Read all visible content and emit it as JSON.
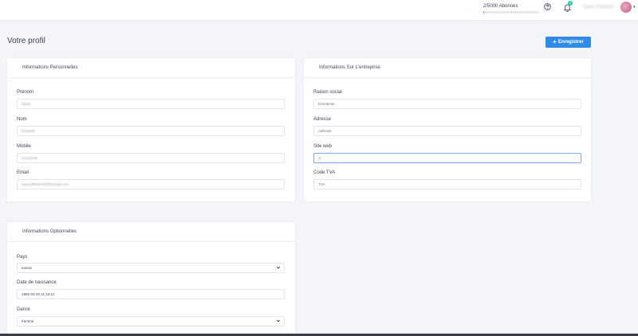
{
  "header": {
    "subscribers_text": "2/5000  Abonnés",
    "subscribers_progress": 0.0004,
    "notification_count": "0",
    "username": "Nadia Khamidi",
    "icons": {
      "help": "help-circle-icon",
      "bell": "bell-icon",
      "caret": "caret-down-icon"
    }
  },
  "page": {
    "title": "Votre profil",
    "save_label": "Enregistrer",
    "accent_color": "#2f8be6"
  },
  "personal": {
    "title": "Informations Personnelles",
    "fields": [
      {
        "label": "Prénom",
        "value": "Nadia"
      },
      {
        "label": "Nom",
        "value": "Khamidi"
      },
      {
        "label": "Mobile",
        "value": "22115039"
      },
      {
        "label": "Email",
        "value": "bayoudkhamidi@hotmail.com"
      }
    ]
  },
  "company": {
    "title": "Informations Sur L'entreprise",
    "fields": [
      {
        "label": "Raison social",
        "placeholder": "Entreprise"
      },
      {
        "label": "Adresse",
        "placeholder": "Adresse"
      },
      {
        "label": "Site web",
        "value": "-|"
      },
      {
        "label": "Code TVA",
        "placeholder": "TVA"
      }
    ]
  },
  "optional": {
    "title": "Informations Optionnelles",
    "fields": [
      {
        "label": "Pays",
        "value": "tunisie"
      },
      {
        "label": "Date de naissance",
        "value": "1992-03-20 11:12:12"
      },
      {
        "label": "Genre",
        "value": "Femme"
      }
    ]
  }
}
